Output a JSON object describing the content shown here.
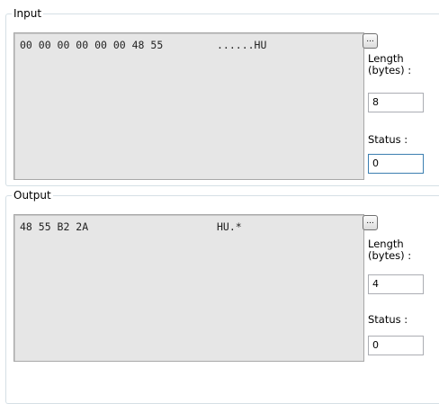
{
  "input": {
    "legend": "Input",
    "hex": "00 00 00 00 00 00 48 55",
    "ascii": "......HU",
    "browse_label": "...",
    "length_label_1": "Length",
    "length_label_2": "(bytes) :",
    "length_value": "8",
    "status_label": "Status :",
    "status_value": "0"
  },
  "output": {
    "legend": "Output",
    "hex": "48 55 B2 2A",
    "ascii": "HU.*",
    "browse_label": "...",
    "length_label_1": "Length",
    "length_label_2": "(bytes) :",
    "length_value": "4",
    "status_label": "Status :",
    "status_value": "0"
  }
}
